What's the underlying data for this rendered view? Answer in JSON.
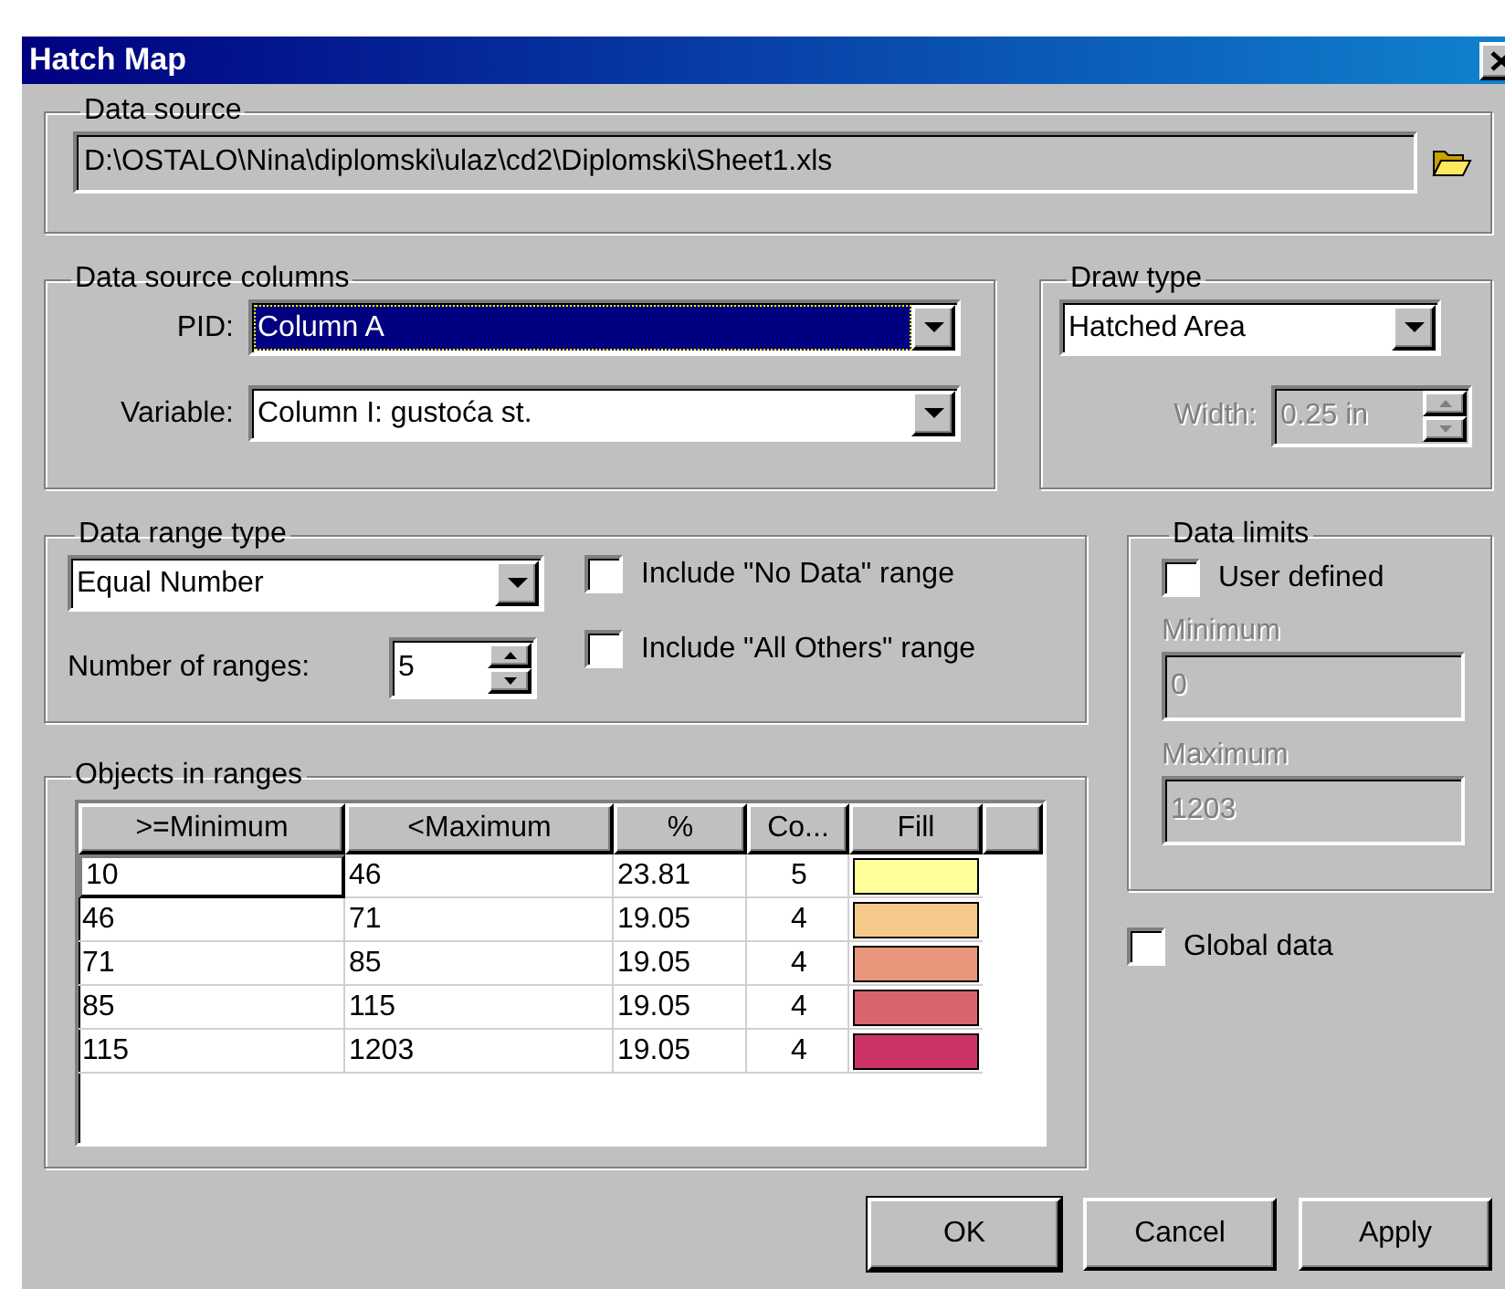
{
  "window": {
    "title": "Hatch Map"
  },
  "data_source": {
    "label": "Data source",
    "path": "D:\\OSTALO\\Nina\\diplomski\\ulaz\\cd2\\Diplomski\\Sheet1.xls"
  },
  "data_source_columns": {
    "label": "Data source columns",
    "fields": [
      {
        "label": "PID:",
        "value": "Column A",
        "focused": true
      },
      {
        "label": "Variable:",
        "value": "Column I: gustoća st.",
        "focused": false
      }
    ]
  },
  "draw_type": {
    "label": "Draw type",
    "value": "Hatched Area",
    "width": {
      "label": "Width:",
      "value": "0.25 in",
      "disabled": true
    }
  },
  "data_range_type": {
    "label": "Data range type",
    "value": "Equal Number",
    "ranges": {
      "label": "Number of ranges:",
      "value": "5"
    },
    "options": [
      {
        "label": "Include \"No Data\" range",
        "checked": false
      },
      {
        "label": "Include \"All Others\" range",
        "checked": false
      }
    ]
  },
  "data_limits": {
    "label": "Data limits",
    "user_defined": {
      "label": "User defined",
      "checked": false
    },
    "fields": [
      {
        "label": "Minimum",
        "value": "0",
        "disabled": true
      },
      {
        "label": "Maximum",
        "value": "1203",
        "disabled": true
      }
    ]
  },
  "objects_in_ranges": {
    "label": "Objects in ranges",
    "columns": [
      ">=Minimum",
      "<Maximum",
      "%",
      "Co...",
      "Fill"
    ],
    "rows": [
      {
        "min": "10",
        "max": "46",
        "percent": "23.81",
        "count": "5",
        "color": "#ffff99",
        "focused": true
      },
      {
        "min": "46",
        "max": "71",
        "percent": "19.05",
        "count": "4",
        "color": "#f5c98a",
        "focused": false
      },
      {
        "min": "71",
        "max": "85",
        "percent": "19.05",
        "count": "4",
        "color": "#e8977c",
        "focused": false
      },
      {
        "min": "85",
        "max": "115",
        "percent": "19.05",
        "count": "4",
        "color": "#d9646e",
        "focused": false
      },
      {
        "min": "115",
        "max": "1203",
        "percent": "19.05",
        "count": "4",
        "color": "#cc3366",
        "focused": false
      }
    ]
  },
  "global_data": {
    "label": "Global data",
    "checked": false
  },
  "buttons": [
    {
      "label": "OK",
      "default": true
    },
    {
      "label": "Cancel",
      "default": false
    },
    {
      "label": "Apply",
      "default": false
    }
  ]
}
